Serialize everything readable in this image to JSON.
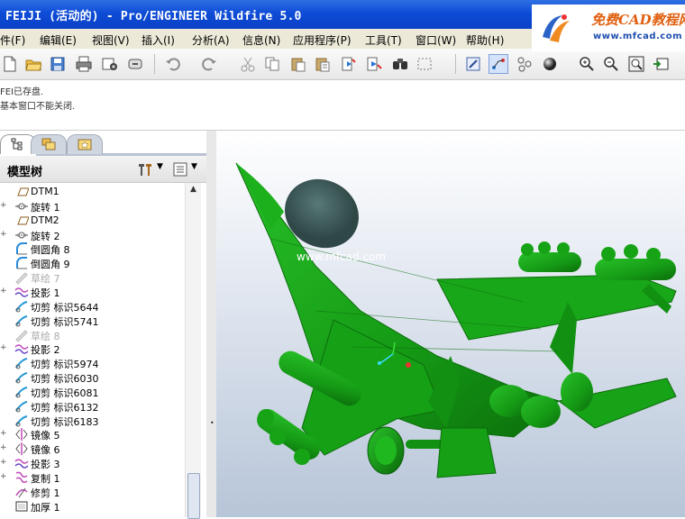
{
  "window": {
    "title": "FEIJI (活动的) - Pro/ENGINEER Wildfire 5.0"
  },
  "logo": {
    "brand": "免费CAD教程网",
    "url": "www.mfcad.com"
  },
  "menu": {
    "items": [
      "件(F)",
      "编辑(E)",
      "视图(V)",
      "插入(I)",
      "分析(A)",
      "信息(N)",
      "应用程序(P)",
      "工具(T)",
      "窗口(W)",
      "帮助(H)"
    ]
  },
  "toolbar": {
    "icons": [
      "new-icon",
      "open-icon",
      "save-icon",
      "print-icon",
      "email-icon",
      "close-window-icon",
      "undo-icon",
      "redo-icon",
      "cut-icon",
      "copy-icon",
      "paste-icon",
      "paste-special-icon",
      "regenerate-icon",
      "regen-manager-icon",
      "find-icon",
      "select-box-icon",
      "repaint-icon",
      "spin-center-icon",
      "orient-icon",
      "render-icon",
      "zoom-in-icon",
      "zoom-out-icon",
      "refit-icon",
      "saved-views-icon"
    ]
  },
  "messages": {
    "line1": "FEI已存盘.",
    "line2": "基本窗口不能关闭."
  },
  "navigator": {
    "tabs": [
      "model-tree-tab",
      "folder-browser-tab",
      "favorites-tab"
    ],
    "header": "模型树",
    "tree": [
      {
        "label": "DTM1",
        "icon": "datum-plane-icon",
        "expandable": false,
        "dim": false
      },
      {
        "label": "旋转 1",
        "icon": "revolve-icon",
        "expandable": true,
        "dim": false
      },
      {
        "label": "DTM2",
        "icon": "datum-plane-icon",
        "expandable": false,
        "dim": false
      },
      {
        "label": "旋转 2",
        "icon": "revolve-icon",
        "expandable": true,
        "dim": false
      },
      {
        "label": "倒圆角 8",
        "icon": "round-icon",
        "expandable": false,
        "dim": false
      },
      {
        "label": "倒圆角 9",
        "icon": "round-icon",
        "expandable": false,
        "dim": false
      },
      {
        "label": "草绘 7",
        "icon": "sketch-icon",
        "expandable": false,
        "dim": true
      },
      {
        "label": "投影 1",
        "icon": "projection-icon",
        "expandable": true,
        "dim": false
      },
      {
        "label": "切剪 标识5644",
        "icon": "cut-feature-icon",
        "expandable": false,
        "dim": false
      },
      {
        "label": "切剪 标识5741",
        "icon": "cut-feature-icon",
        "expandable": false,
        "dim": false
      },
      {
        "label": "草绘 8",
        "icon": "sketch-icon",
        "expandable": false,
        "dim": true
      },
      {
        "label": "投影 2",
        "icon": "projection-icon",
        "expandable": true,
        "dim": false
      },
      {
        "label": "切剪 标识5974",
        "icon": "cut-feature-icon",
        "expandable": false,
        "dim": false
      },
      {
        "label": "切剪 标识6030",
        "icon": "cut-feature-icon",
        "expandable": false,
        "dim": false
      },
      {
        "label": "切剪 标识6081",
        "icon": "cut-feature-icon",
        "expandable": false,
        "dim": false
      },
      {
        "label": "切剪 标识6132",
        "icon": "cut-feature-icon",
        "expandable": false,
        "dim": false
      },
      {
        "label": "切剪 标识6183",
        "icon": "cut-feature-icon",
        "expandable": false,
        "dim": false
      },
      {
        "label": "镜像 5",
        "icon": "mirror-icon",
        "expandable": true,
        "dim": false
      },
      {
        "label": "镜像 6",
        "icon": "mirror-icon",
        "expandable": true,
        "dim": false
      },
      {
        "label": "投影 3",
        "icon": "projection-icon",
        "expandable": true,
        "dim": false
      },
      {
        "label": "复制 1",
        "icon": "copy-feature-icon",
        "expandable": true,
        "dim": false
      },
      {
        "label": "修剪 1",
        "icon": "trim-icon",
        "expandable": false,
        "dim": false
      },
      {
        "label": "加厚 1",
        "icon": "thicken-icon",
        "expandable": false,
        "dim": false
      }
    ]
  },
  "graphics": {
    "watermark": "www.mfcad.com",
    "model": "jet-fighter-model",
    "model_color": "#16a316",
    "canopy_color": "#3d5a5a"
  }
}
